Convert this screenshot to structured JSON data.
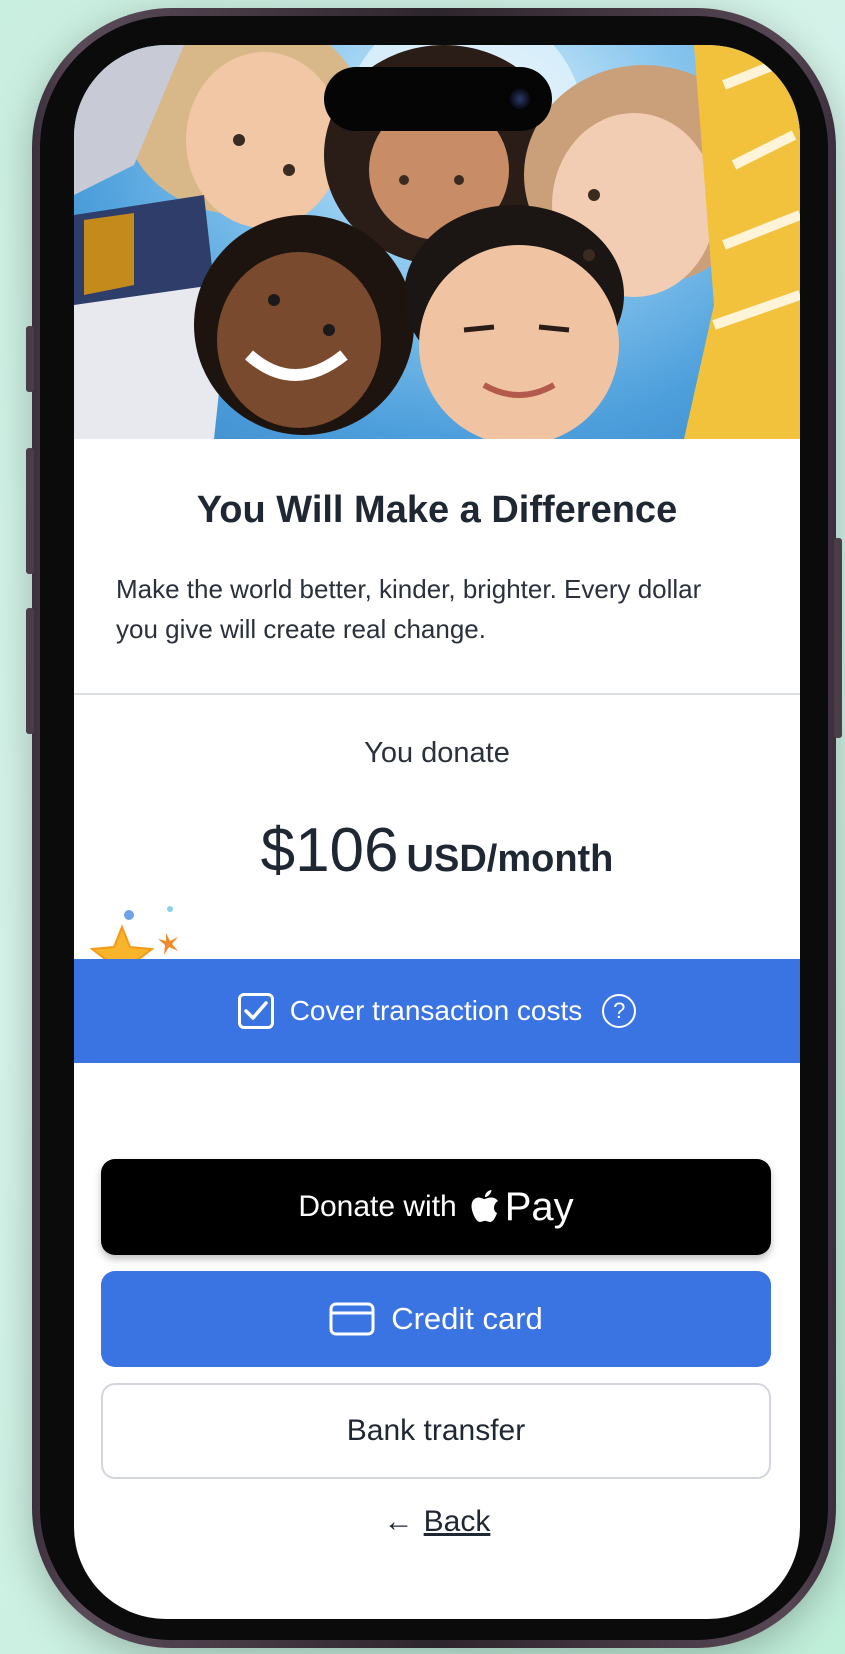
{
  "hero": {
    "image_description_icon": "group-of-children-photo"
  },
  "content": {
    "title": "You Will Make a Difference",
    "subtitle": "Make the world better, kinder, brighter. Every dollar you give will create real change."
  },
  "donation": {
    "label": "You donate",
    "amount": "$106",
    "period": "USD/month"
  },
  "cover": {
    "checked": true,
    "label": "Cover transaction costs",
    "help_icon": "?"
  },
  "buttons": {
    "apple_pay_prefix": "Donate with",
    "apple_pay_brand": "Pay",
    "credit_card": "Credit card",
    "bank_transfer": "Bank transfer"
  },
  "back": {
    "arrow": "←",
    "label": "Back"
  },
  "colors": {
    "accent_blue": "#3a74e2",
    "text_dark": "#1f2733",
    "apple_black": "#000000"
  }
}
